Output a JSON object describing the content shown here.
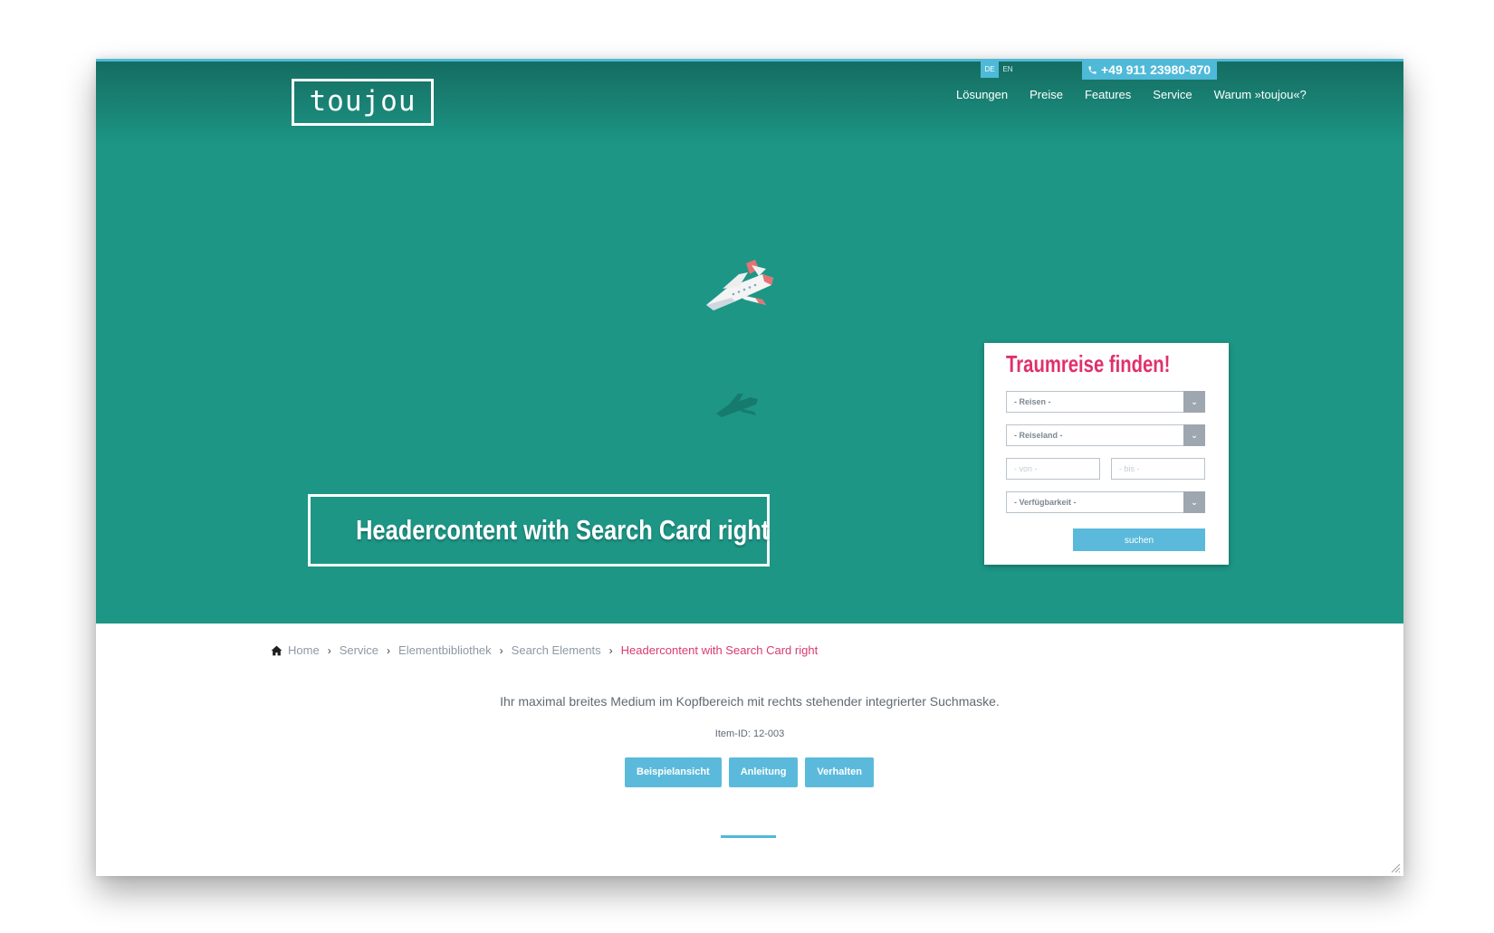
{
  "brand": {
    "logo_text": "toujou"
  },
  "header": {
    "languages": [
      {
        "label": "DE",
        "active": true
      },
      {
        "label": "EN",
        "active": false
      }
    ],
    "phone": "+49 911 23980-870",
    "nav": [
      {
        "label": "Lösungen"
      },
      {
        "label": "Preise"
      },
      {
        "label": "Features"
      },
      {
        "label": "Service"
      },
      {
        "label": "Warum »toujou«?"
      }
    ]
  },
  "hero": {
    "title": "Headercontent with Search Card right",
    "background_color": "#1d9686",
    "illustration": "airplane-icon"
  },
  "search_card": {
    "title": "Traumreise finden!",
    "reisen": "- Reisen -",
    "reiseland": "- Reiseland -",
    "von": "- von -",
    "bis": "- bis -",
    "verfuegbarkeit": "- Verfügbarkeit -",
    "submit": "suchen",
    "title_color": "#e0306c",
    "button_color": "#5bbadb"
  },
  "breadcrumb": {
    "home": "Home",
    "items": [
      "Service",
      "Elementbibliothek",
      "Search Elements"
    ],
    "current": "Headercontent with Search Card right"
  },
  "content": {
    "description": "Ihr maximal breites Medium im Kopfbereich mit rechts stehender integrierter Suchmaske.",
    "item_id": "Item-ID: 12-003",
    "buttons": [
      {
        "label": "Beispielansicht"
      },
      {
        "label": "Anleitung"
      },
      {
        "label": "Verhalten"
      }
    ],
    "accent_color": "#4fb9d8"
  }
}
